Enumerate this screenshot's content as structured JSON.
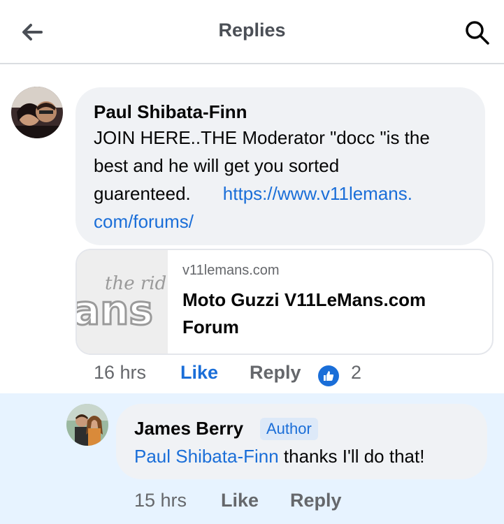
{
  "header": {
    "title": "Replies",
    "back_icon": "arrow-left-icon",
    "search_icon": "search-icon"
  },
  "comment": {
    "author": "Paul Shibata-Finn",
    "text_line1": "JOIN HERE..THE Moderator \"docc \"is the",
    "text_line2": "best and he will get you sorted",
    "text_line3": "guarenteed.",
    "link_part1": "https://www.v11lemans.",
    "link_part2": "com/forums/",
    "time": "16 hrs",
    "like_label": "Like",
    "reply_label": "Reply",
    "reaction_count": "2"
  },
  "preview": {
    "domain": "v11lemans.com",
    "title": "Moto Guzzi V11LeMans.com Forum"
  },
  "reply": {
    "author": "James Berry",
    "badge": "Author",
    "mention": "Paul Shibata-Finn",
    "text": " thanks I'll do that!",
    "time": "15 hrs",
    "like_label": "Like",
    "reply_label": "Reply"
  },
  "colors": {
    "link_blue": "#1a6ed8",
    "bubble_bg": "#f0f2f5",
    "highlight_bg": "#e7f3ff",
    "secondary_text": "#65676b"
  }
}
